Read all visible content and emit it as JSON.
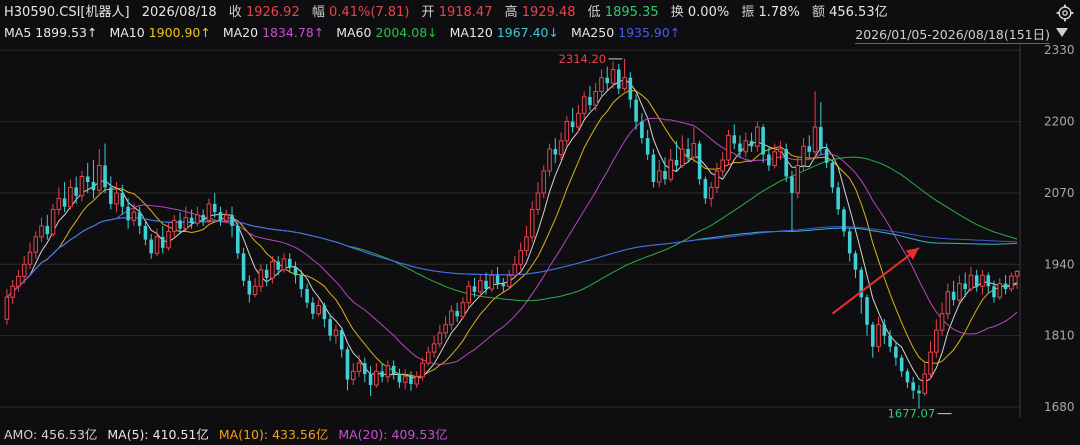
{
  "header": {
    "symbol": "H30590.CSI[机器人]",
    "date": "2026/08/18",
    "close_label": "收",
    "close": "1926.92",
    "change_label": "幅",
    "change": "0.41%(7.81)",
    "open_label": "开",
    "open": "1918.47",
    "high_label": "高",
    "high": "1929.48",
    "low_label": "低",
    "low": "1895.35",
    "turnover_label": "换",
    "turnover": "0.00%",
    "amplitude_label": "振",
    "amplitude": "1.78%",
    "amount_label": "额",
    "amount": "456.53亿"
  },
  "ma_legend": [
    {
      "label": "MA5",
      "value": "1899.53↑",
      "color": "#e8e8e8"
    },
    {
      "label": "MA10",
      "value": "1900.90↑",
      "color": "#f0c419"
    },
    {
      "label": "MA20",
      "value": "1834.78↑",
      "color": "#c84fd0"
    },
    {
      "label": "MA60",
      "value": "2004.08↓",
      "color": "#2fbf4a"
    },
    {
      "label": "MA120",
      "value": "1967.40↓",
      "color": "#3ec6d8"
    },
    {
      "label": "MA250",
      "value": "1935.90↑",
      "color": "#4a5cf0"
    }
  ],
  "date_range": "2026/01/05-2026/08/18(151日)",
  "amo": {
    "label": "AMO:",
    "value": "456.53亿",
    "ma5_label": "MA(5):",
    "ma5": "410.51亿",
    "ma10_label": "MA(10):",
    "ma10": "433.56亿",
    "ma20_label": "MA(20):",
    "ma20": "409.53亿"
  },
  "colors": {
    "up": "#e8434c",
    "down": "#3fd0d4",
    "ma5": "#e8e8e8",
    "ma10": "#f0c419",
    "ma20": "#c84fd0",
    "ma60": "#2fbf4a",
    "ma120": "#3ec6d8",
    "ma250": "#4a5cf0",
    "arrow": "#e8302a"
  },
  "chart_data": {
    "type": "candlestick",
    "y_ticks": [
      "2330",
      "2200",
      "2070",
      "1940",
      "1810",
      "1680"
    ],
    "ylim": [
      1660,
      2345
    ],
    "annotations": [
      {
        "text": "2314.20",
        "price": 2314.2,
        "index": 107
      },
      {
        "text": "1677.07",
        "price": 1677.07,
        "index": 164
      }
    ],
    "candles": [
      [
        1840,
        1880,
        1895,
        1830
      ],
      [
        1880,
        1900,
        1912,
        1868
      ],
      [
        1900,
        1918,
        1930,
        1890
      ],
      [
        1918,
        1940,
        1955,
        1905
      ],
      [
        1940,
        1962,
        1980,
        1932
      ],
      [
        1962,
        1990,
        2000,
        1950
      ],
      [
        1990,
        2010,
        2025,
        1980
      ],
      [
        2010,
        1995,
        2030,
        1985
      ],
      [
        1995,
        2040,
        2050,
        1990
      ],
      [
        2040,
        2060,
        2080,
        2030
      ],
      [
        2060,
        2045,
        2090,
        2035
      ],
      [
        2045,
        2080,
        2095,
        2040
      ],
      [
        2080,
        2065,
        2100,
        2050
      ],
      [
        2065,
        2100,
        2110,
        2055
      ],
      [
        2100,
        2090,
        2125,
        2070
      ],
      [
        2090,
        2075,
        2130,
        2060
      ],
      [
        2075,
        2120,
        2150,
        2065
      ],
      [
        2120,
        2080,
        2160,
        2070
      ],
      [
        2080,
        2050,
        2100,
        2040
      ],
      [
        2050,
        2070,
        2090,
        2035
      ],
      [
        2070,
        2045,
        2085,
        2030
      ],
      [
        2045,
        2020,
        2060,
        2005
      ],
      [
        2020,
        2035,
        2050,
        2010
      ],
      [
        2035,
        2010,
        2045,
        1995
      ],
      [
        2010,
        1985,
        2020,
        1975
      ],
      [
        1985,
        1960,
        1995,
        1950
      ],
      [
        1960,
        1990,
        2005,
        1955
      ],
      [
        1990,
        1970,
        2010,
        1960
      ],
      [
        1970,
        2000,
        2015,
        1965
      ],
      [
        2000,
        2020,
        2030,
        1990
      ],
      [
        2020,
        2005,
        2035,
        1995
      ],
      [
        2005,
        2025,
        2045,
        2000
      ],
      [
        2025,
        2015,
        2040,
        2005
      ],
      [
        2015,
        2030,
        2045,
        2010
      ],
      [
        2030,
        2020,
        2040,
        2010
      ],
      [
        2020,
        2050,
        2060,
        2015
      ],
      [
        2050,
        2035,
        2070,
        2025
      ],
      [
        2035,
        2020,
        2045,
        2010
      ],
      [
        2020,
        2030,
        2040,
        2015
      ],
      [
        2030,
        2010,
        2045,
        1990
      ],
      [
        2010,
        1960,
        2015,
        1950
      ],
      [
        1960,
        1910,
        1970,
        1900
      ],
      [
        1910,
        1885,
        1920,
        1870
      ],
      [
        1885,
        1900,
        1915,
        1880
      ],
      [
        1900,
        1930,
        1940,
        1890
      ],
      [
        1930,
        1915,
        1940,
        1900
      ],
      [
        1915,
        1945,
        1955,
        1905
      ],
      [
        1945,
        1930,
        1955,
        1920
      ],
      [
        1930,
        1950,
        1960,
        1925
      ],
      [
        1950,
        1935,
        1960,
        1925
      ],
      [
        1935,
        1920,
        1945,
        1905
      ],
      [
        1920,
        1895,
        1930,
        1880
      ],
      [
        1895,
        1870,
        1905,
        1860
      ],
      [
        1870,
        1850,
        1880,
        1840
      ],
      [
        1850,
        1865,
        1875,
        1845
      ],
      [
        1865,
        1840,
        1870,
        1825
      ],
      [
        1840,
        1810,
        1850,
        1800
      ],
      [
        1810,
        1820,
        1830,
        1795
      ],
      [
        1820,
        1785,
        1825,
        1770
      ],
      [
        1785,
        1730,
        1790,
        1710
      ],
      [
        1730,
        1745,
        1760,
        1720
      ],
      [
        1745,
        1760,
        1775,
        1735
      ],
      [
        1760,
        1740,
        1770,
        1725
      ],
      [
        1740,
        1720,
        1755,
        1700
      ],
      [
        1720,
        1745,
        1760,
        1715
      ],
      [
        1745,
        1735,
        1760,
        1725
      ],
      [
        1735,
        1755,
        1765,
        1725
      ],
      [
        1755,
        1740,
        1765,
        1730
      ],
      [
        1740,
        1725,
        1750,
        1715
      ],
      [
        1725,
        1735,
        1748,
        1712
      ],
      [
        1735,
        1722,
        1745,
        1710
      ],
      [
        1722,
        1735,
        1745,
        1715
      ],
      [
        1735,
        1760,
        1770,
        1728
      ],
      [
        1760,
        1780,
        1790,
        1755
      ],
      [
        1780,
        1795,
        1810,
        1770
      ],
      [
        1795,
        1815,
        1830,
        1788
      ],
      [
        1815,
        1830,
        1845,
        1805
      ],
      [
        1830,
        1855,
        1865,
        1820
      ],
      [
        1855,
        1845,
        1870,
        1835
      ],
      [
        1845,
        1870,
        1880,
        1840
      ],
      [
        1870,
        1900,
        1910,
        1860
      ],
      [
        1900,
        1890,
        1915,
        1880
      ],
      [
        1890,
        1910,
        1920,
        1880
      ],
      [
        1910,
        1895,
        1925,
        1885
      ],
      [
        1895,
        1920,
        1930,
        1890
      ],
      [
        1920,
        1905,
        1935,
        1895
      ],
      [
        1905,
        1900,
        1915,
        1890
      ],
      [
        1900,
        1920,
        1930,
        1895
      ],
      [
        1920,
        1940,
        1955,
        1915
      ],
      [
        1940,
        1965,
        1980,
        1930
      ],
      [
        1965,
        1990,
        2010,
        1955
      ],
      [
        1990,
        2040,
        2055,
        1980
      ],
      [
        2040,
        2070,
        2090,
        2030
      ],
      [
        2070,
        2110,
        2120,
        2060
      ],
      [
        2110,
        2150,
        2160,
        2100
      ],
      [
        2150,
        2140,
        2170,
        2125
      ],
      [
        2140,
        2165,
        2180,
        2130
      ],
      [
        2165,
        2200,
        2210,
        2155
      ],
      [
        2200,
        2190,
        2225,
        2180
      ],
      [
        2190,
        2215,
        2230,
        2180
      ],
      [
        2215,
        2245,
        2255,
        2205
      ],
      [
        2245,
        2230,
        2265,
        2220
      ],
      [
        2230,
        2255,
        2270,
        2220
      ],
      [
        2255,
        2280,
        2295,
        2245
      ],
      [
        2280,
        2270,
        2300,
        2255
      ],
      [
        2270,
        2295,
        2310,
        2260
      ],
      [
        2295,
        2260,
        2305,
        2250
      ],
      [
        2260,
        2280,
        2314.2,
        2255
      ],
      [
        2280,
        2240,
        2290,
        2225
      ],
      [
        2240,
        2200,
        2250,
        2185
      ],
      [
        2200,
        2170,
        2215,
        2160
      ],
      [
        2170,
        2140,
        2185,
        2130
      ],
      [
        2140,
        2090,
        2150,
        2080
      ],
      [
        2090,
        2110,
        2130,
        2080
      ],
      [
        2110,
        2095,
        2135,
        2085
      ],
      [
        2095,
        2130,
        2150,
        2090
      ],
      [
        2130,
        2120,
        2165,
        2110
      ],
      [
        2120,
        2150,
        2175,
        2115
      ],
      [
        2150,
        2135,
        2170,
        2125
      ],
      [
        2135,
        2160,
        2190,
        2125
      ],
      [
        2160,
        2095,
        2165,
        2085
      ],
      [
        2095,
        2060,
        2100,
        2050
      ],
      [
        2060,
        2080,
        2090,
        2045
      ],
      [
        2080,
        2110,
        2125,
        2070
      ],
      [
        2110,
        2130,
        2145,
        2100
      ],
      [
        2130,
        2175,
        2185,
        2120
      ],
      [
        2175,
        2160,
        2195,
        2150
      ],
      [
        2160,
        2145,
        2175,
        2135
      ],
      [
        2145,
        2165,
        2180,
        2135
      ],
      [
        2165,
        2155,
        2180,
        2145
      ],
      [
        2155,
        2190,
        2200,
        2145
      ],
      [
        2190,
        2140,
        2195,
        2125
      ],
      [
        2140,
        2120,
        2155,
        2110
      ],
      [
        2120,
        2145,
        2160,
        2115
      ],
      [
        2145,
        2150,
        2165,
        2130
      ],
      [
        2150,
        2100,
        2160,
        2090
      ],
      [
        2100,
        2070,
        2110,
        2000
      ],
      [
        2070,
        2120,
        2135,
        2060
      ],
      [
        2120,
        2155,
        2170,
        2110
      ],
      [
        2155,
        2145,
        2175,
        2135
      ],
      [
        2145,
        2190,
        2255,
        2140
      ],
      [
        2190,
        2150,
        2235,
        2140
      ],
      [
        2150,
        2125,
        2160,
        2115
      ],
      [
        2125,
        2080,
        2130,
        2070
      ],
      [
        2080,
        2040,
        2090,
        2030
      ],
      [
        2040,
        2000,
        2045,
        1990
      ],
      [
        2000,
        1960,
        2005,
        1945
      ],
      [
        1960,
        1930,
        1965,
        1915
      ],
      [
        1930,
        1880,
        1935,
        1850
      ],
      [
        1880,
        1830,
        1885,
        1810
      ],
      [
        1830,
        1790,
        1835,
        1770
      ],
      [
        1790,
        1830,
        1845,
        1780
      ],
      [
        1830,
        1810,
        1840,
        1795
      ],
      [
        1810,
        1790,
        1820,
        1780
      ],
      [
        1790,
        1770,
        1800,
        1755
      ],
      [
        1770,
        1745,
        1775,
        1735
      ],
      [
        1745,
        1725,
        1750,
        1715
      ],
      [
        1725,
        1710,
        1735,
        1695
      ],
      [
        1710,
        1705,
        1720,
        1677.07
      ],
      [
        1705,
        1740,
        1760,
        1700
      ],
      [
        1740,
        1780,
        1800,
        1730
      ],
      [
        1780,
        1820,
        1840,
        1770
      ],
      [
        1820,
        1850,
        1870,
        1810
      ],
      [
        1850,
        1890,
        1905,
        1840
      ],
      [
        1890,
        1875,
        1910,
        1865
      ],
      [
        1875,
        1905,
        1920,
        1870
      ],
      [
        1905,
        1895,
        1925,
        1880
      ],
      [
        1895,
        1920,
        1935,
        1890
      ],
      [
        1920,
        1900,
        1930,
        1890
      ],
      [
        1900,
        1920,
        1930,
        1885
      ],
      [
        1920,
        1900,
        1925,
        1888
      ],
      [
        1900,
        1880,
        1910,
        1870
      ],
      [
        1880,
        1905,
        1915,
        1875
      ],
      [
        1905,
        1895,
        1920,
        1885
      ],
      [
        1895,
        1918.47,
        1925,
        1890
      ],
      [
        1918.47,
        1926.92,
        1929.48,
        1895.35
      ]
    ]
  }
}
